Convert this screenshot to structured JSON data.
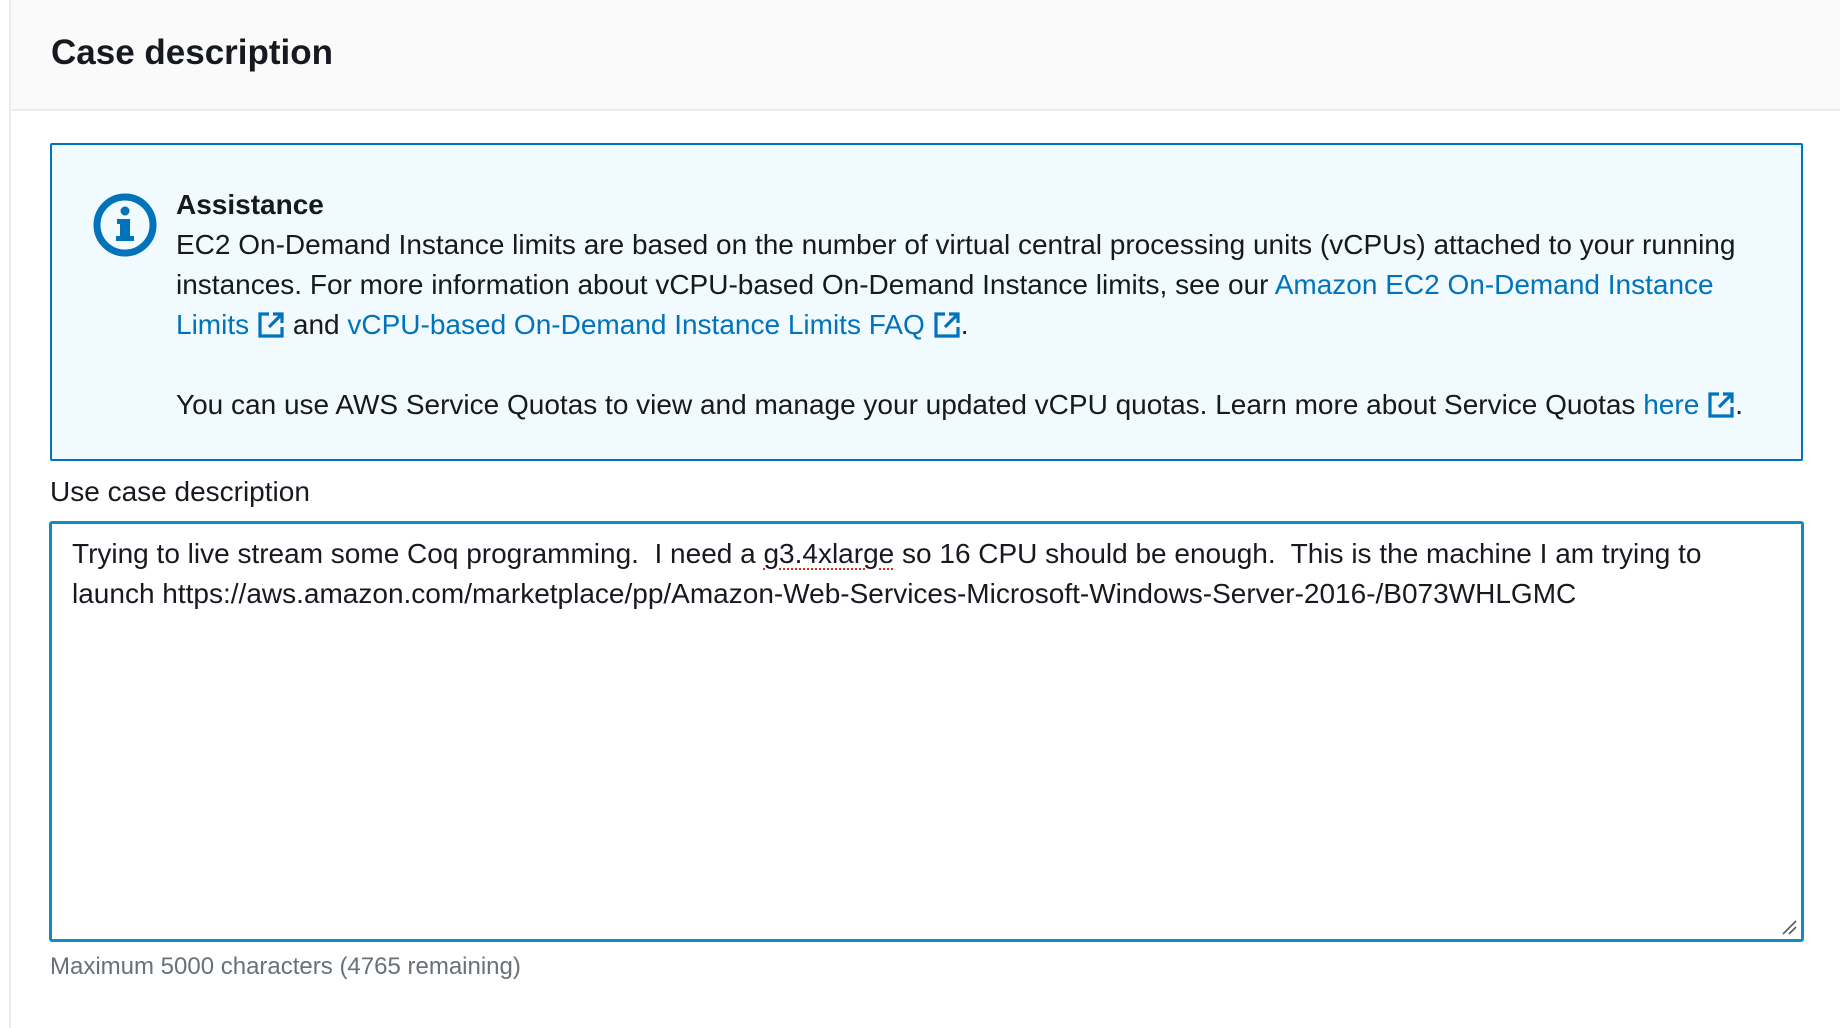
{
  "header": {
    "title": "Case description"
  },
  "assistance": {
    "icon": "info-icon",
    "title": "Assistance",
    "para1_prefix": "EC2 On-Demand Instance limits are based on the number of virtual central processing units (vCPUs) attached to your running instances. For more information about vCPU-based On-Demand Instance limits, see our ",
    "link1": "Amazon EC2 On-Demand Instance Limits",
    "para1_mid": " and ",
    "link2": "vCPU-based On-Demand Instance Limits FAQ",
    "para1_end": ".",
    "para2_prefix": "You can use AWS Service Quotas to view and manage your updated vCPU quotas. Learn more about Service Quotas ",
    "link3": "here",
    "para2_end": "."
  },
  "use_case": {
    "label": "Use case description",
    "value_part1": "Trying to live stream some Coq programming.  I need a ",
    "value_misspelled": "g3.4xlarge",
    "value_part2": " so 16 CPU should be enough.  This is the machine I am trying to launch https://aws.amazon.com/marketplace/pp/Amazon-Web-Services-Microsoft-Windows-Server-2016-/B073WHLGMC",
    "constraint": "Maximum 5000 characters (4765 remaining)"
  },
  "colors": {
    "link": "#0073bb",
    "info_border": "#0073bb",
    "info_background": "#f1faff",
    "focus_border": "#0f8cc2"
  }
}
